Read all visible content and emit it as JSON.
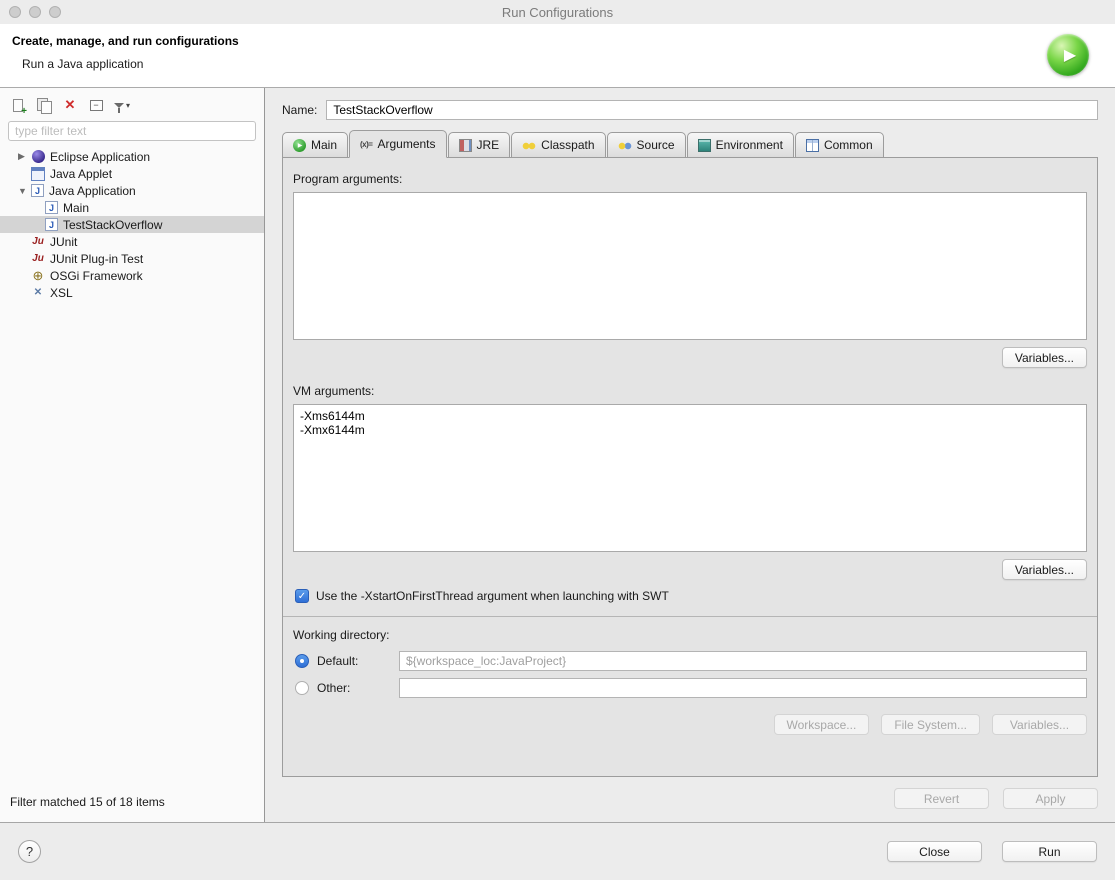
{
  "window": {
    "title": "Run Configurations"
  },
  "header": {
    "title": "Create, manage, and run configurations",
    "subtitle": "Run a Java application"
  },
  "icons": {
    "collapsed_glyph": "▶",
    "expanded_glyph": "▼",
    "delete_glyph": "✕",
    "filter_caret": "▾",
    "arguments_glyph": "(x)=",
    "run_arrow": "▶",
    "help_glyph": "?",
    "check_glyph": "✓",
    "java_letter": "J",
    "junit_letters": "Ju",
    "osgi_glyph": "⊕",
    "xsl_glyph": "✕"
  },
  "sidebar": {
    "filter_placeholder": "type filter text",
    "status": "Filter matched 15 of 18 items",
    "tree": [
      {
        "label": "Eclipse Application",
        "state": "collapsed"
      },
      {
        "label": "Java Applet"
      },
      {
        "label": "Java Application",
        "state": "expanded"
      },
      {
        "label": "Main"
      },
      {
        "label": "TestStackOverflow",
        "selected": true
      },
      {
        "label": "JUnit"
      },
      {
        "label": "JUnit Plug-in Test"
      },
      {
        "label": "OSGi Framework"
      },
      {
        "label": "XSL"
      }
    ]
  },
  "name_field": {
    "label": "Name:",
    "value": "TestStackOverflow"
  },
  "tabs": [
    {
      "label": "Main"
    },
    {
      "label": "Arguments",
      "active": true
    },
    {
      "label": "JRE"
    },
    {
      "label": "Classpath"
    },
    {
      "label": "Source"
    },
    {
      "label": "Environment"
    },
    {
      "label": "Common"
    }
  ],
  "arguments_tab": {
    "program_arguments_label": "Program arguments:",
    "program_arguments_value": "",
    "variables_button": "Variables...",
    "vm_arguments_label": "VM arguments:",
    "vm_arguments_value": "-Xms6144m\n-Xmx6144m",
    "swt_checkbox_label": "Use the -XstartOnFirstThread argument when launching with SWT",
    "swt_checkbox_checked": true,
    "working_directory": {
      "section_label": "Working directory:",
      "default_label": "Default:",
      "default_value": "${workspace_loc:JavaProject}",
      "other_label": "Other:",
      "other_value": "",
      "workspace_button": "Workspace...",
      "filesystem_button": "File System...",
      "variables_button": "Variables..."
    }
  },
  "buttons": {
    "revert": "Revert",
    "apply": "Apply",
    "close": "Close",
    "run": "Run"
  }
}
